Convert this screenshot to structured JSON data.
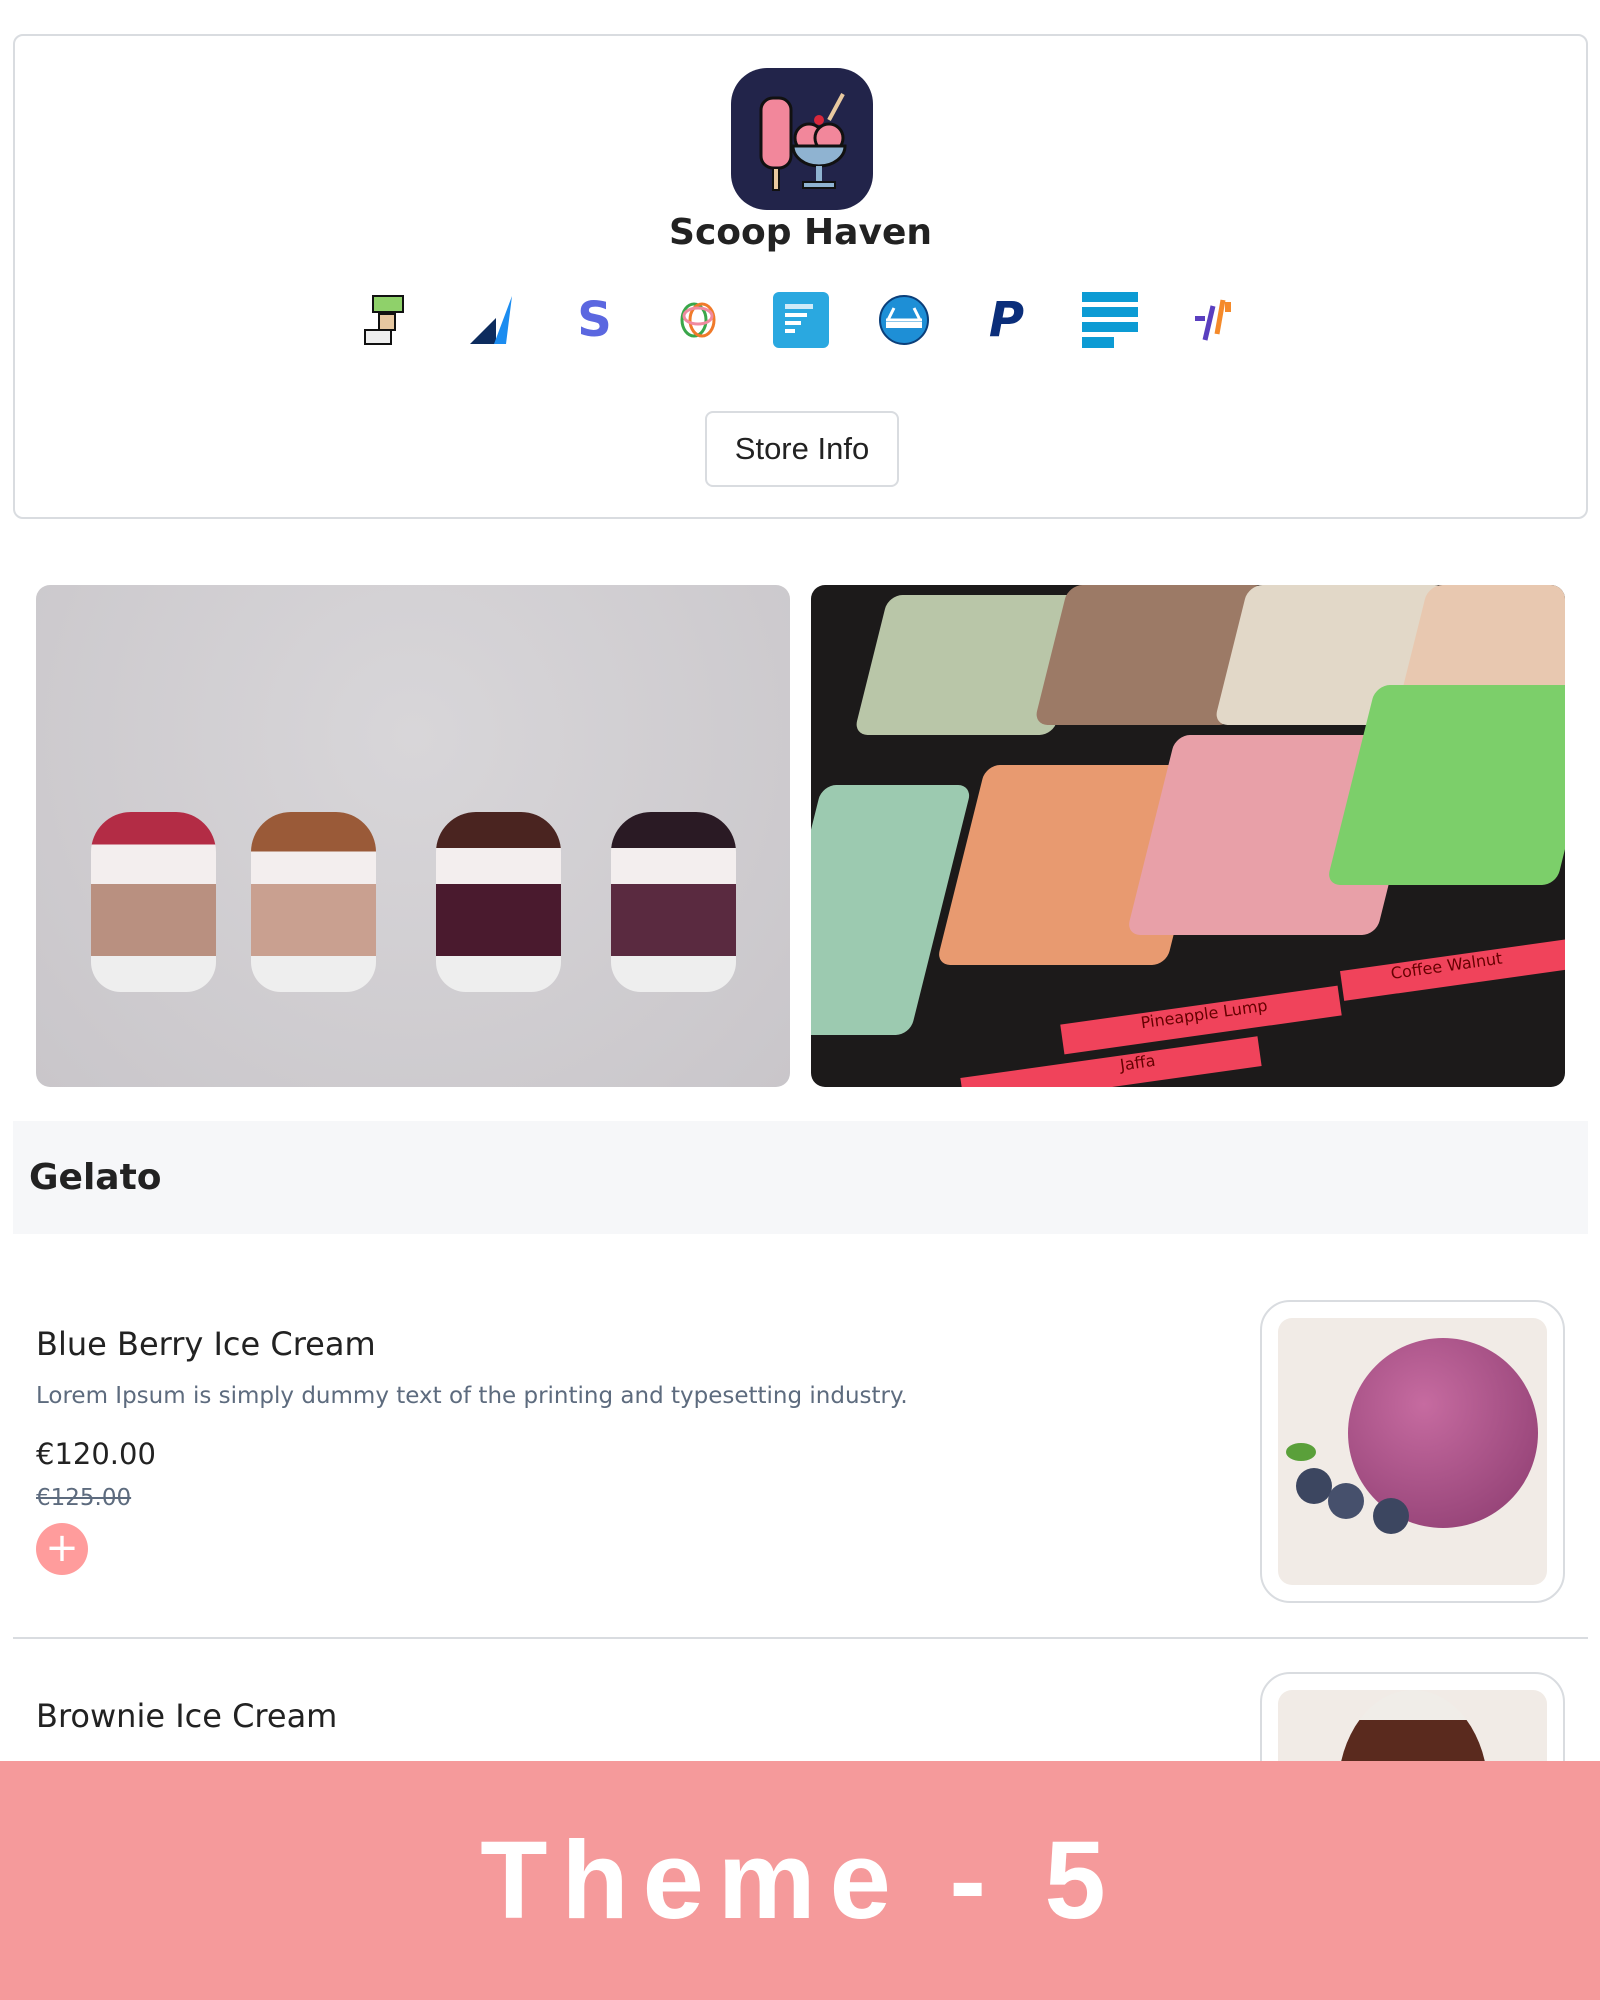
{
  "store": {
    "name": "Scoop Haven",
    "store_info_label": "Store Info"
  },
  "payment_icons": [
    "cash-hand-icon",
    "arrow-brand-icon",
    "stripe-s-icon",
    "heart-rings-icon",
    "document-icon",
    "scale-brand-icon",
    "paypal-icon",
    "stacked-bars-icon",
    "slash-brand-icon"
  ],
  "banner_signs": [
    "Coffee Walnut",
    "Pineapple Lump",
    "Jaffa"
  ],
  "section": {
    "title": "Gelato"
  },
  "items": [
    {
      "name": "Blue Berry Ice Cream",
      "description": "Lorem Ipsum is simply dummy text of the printing and typesetting industry.",
      "price": "€120.00",
      "old_price": "€125.00"
    },
    {
      "name": "Brownie Ice Cream"
    }
  ],
  "footer_banner": {
    "text": "Theme - 5"
  },
  "colors": {
    "accent": "#ff9c9c",
    "banner": "#f59a9b",
    "logo_bg": "#22244a"
  }
}
